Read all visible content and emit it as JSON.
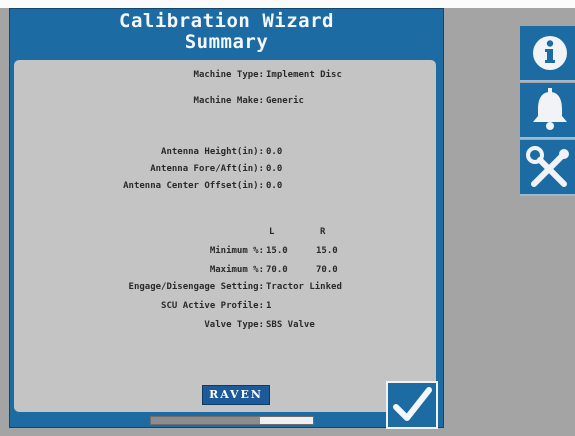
{
  "dialog": {
    "title_line1": "Calibration Wizard",
    "title_line2": "Summary"
  },
  "summary": {
    "machine_type_label": "Machine Type:",
    "machine_type_value": "Implement Disc",
    "machine_make_label": "Machine Make:",
    "machine_make_value": "Generic",
    "antenna_height_label": "Antenna Height(in):",
    "antenna_height_value": "0.0",
    "antenna_fore_aft_label": "Antenna Fore/Aft(in):",
    "antenna_fore_aft_value": "0.0",
    "antenna_center_offset_label": "Antenna Center Offset(in):",
    "antenna_center_offset_value": "0.0",
    "col_left": "L",
    "col_right": "R",
    "minimum_label": "Minimum %:",
    "minimum_left": "15.0",
    "minimum_right": "15.0",
    "maximum_label": "Maximum %:",
    "maximum_left": "70.0",
    "maximum_right": "70.0",
    "engage_label": "Engage/Disengage Setting:",
    "engage_value": "Tractor Linked",
    "scu_label": "SCU Active Profile:",
    "scu_value": "1",
    "valve_type_label": "Valve Type:",
    "valve_type_value": "SBS Valve"
  },
  "logo": {
    "text": "RAVEN"
  },
  "progress": {
    "fraction": 0.67
  },
  "icons": {
    "accept": "checkmark-icon",
    "info": "info-icon",
    "alarm": "bell-icon",
    "tools": "tools-icon"
  },
  "colors": {
    "accent": "#1d6ba3",
    "panel": "#c4c4c4",
    "background": "#a4a4a4"
  }
}
